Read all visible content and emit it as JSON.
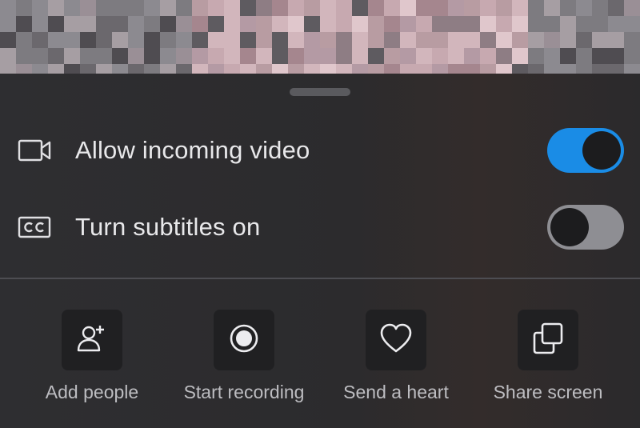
{
  "options": [
    {
      "label": "Allow incoming video",
      "icon": "video-camera-icon",
      "enabled": true
    },
    {
      "label": "Turn subtitles on",
      "icon": "closed-captions-icon",
      "enabled": false
    }
  ],
  "actions": [
    {
      "label": "Add people",
      "icon": "add-person-icon"
    },
    {
      "label": "Start recording",
      "icon": "record-icon"
    },
    {
      "label": "Send a heart",
      "icon": "heart-icon"
    },
    {
      "label": "Share screen",
      "icon": "share-screen-icon"
    }
  ],
  "colors": {
    "accent": "#1a8ce6",
    "panel": "#2c2c2e",
    "text": "#e8e8ea"
  }
}
